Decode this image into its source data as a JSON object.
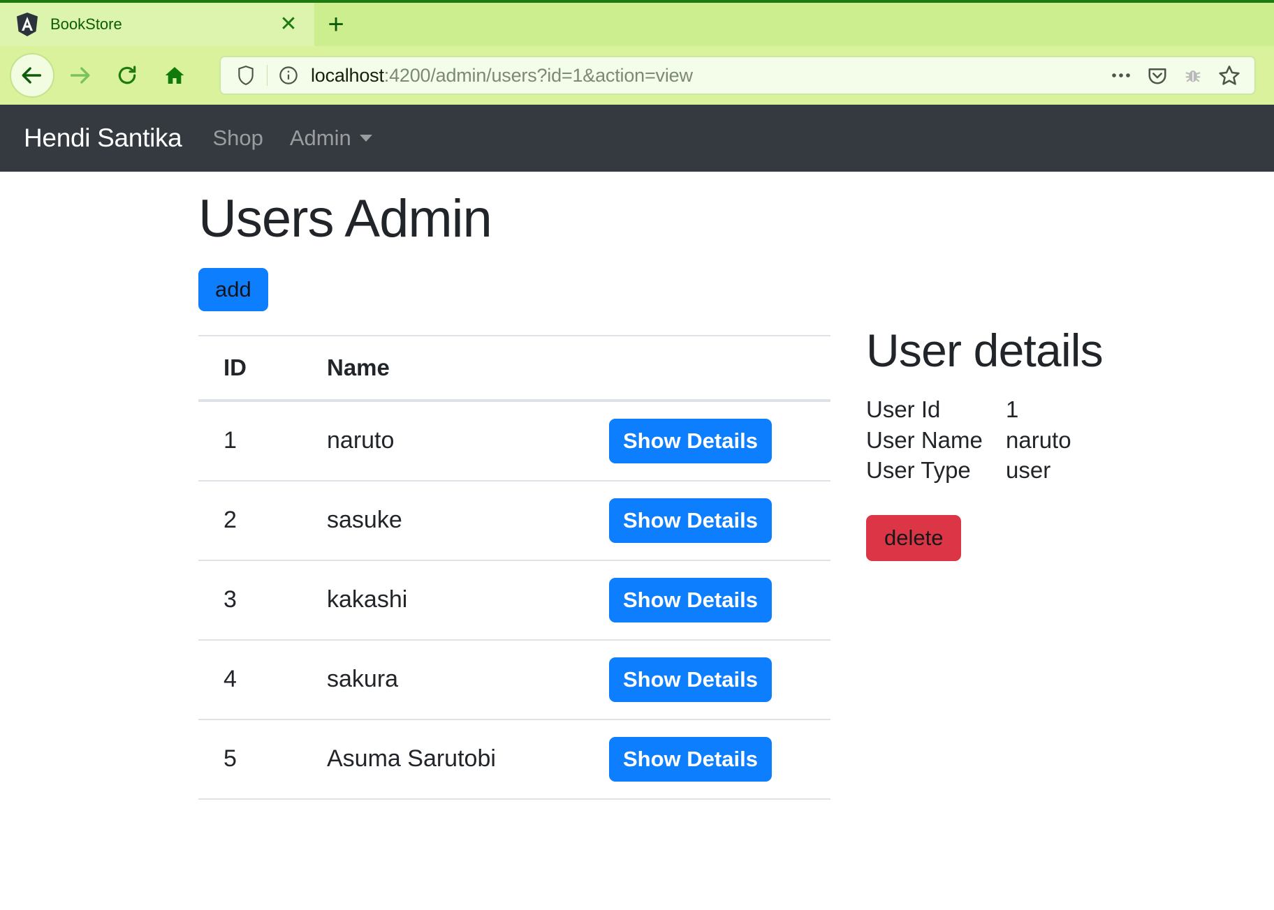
{
  "browser": {
    "tab": {
      "title": "BookStore",
      "favicon": "angular-logo-icon",
      "close": "✕"
    },
    "new_tab": "+",
    "nav": {
      "back": "back-arrow-icon",
      "forward": "forward-arrow-icon",
      "reload": "reload-icon",
      "home": "home-icon"
    },
    "url": {
      "host": "localhost",
      "rest": ":4200/admin/users?id=1&action=view",
      "full": "localhost:4200/admin/users?id=1&action=view",
      "shield_icon": "tracking-protection-shield-icon",
      "info_icon": "site-info-icon"
    },
    "url_actions": [
      "page-actions-ellipsis-icon",
      "pocket-icon",
      "debug-bug-icon",
      "bookmark-star-icon"
    ],
    "theme_accent": "#d9f29b"
  },
  "app_navbar": {
    "brand": "Hendi Santika",
    "links": [
      {
        "label": "Shop",
        "dropdown": false
      },
      {
        "label": "Admin",
        "dropdown": true
      }
    ]
  },
  "main": {
    "title": "Users Admin",
    "add_label": "add",
    "table": {
      "columns": [
        "ID",
        "Name",
        ""
      ],
      "action_label": "Show Details",
      "rows": [
        {
          "id": "1",
          "name": "naruto"
        },
        {
          "id": "2",
          "name": "sasuke"
        },
        {
          "id": "3",
          "name": "kakashi"
        },
        {
          "id": "4",
          "name": "sakura"
        },
        {
          "id": "5",
          "name": "Asuma Sarutobi"
        }
      ]
    }
  },
  "details": {
    "title": "User details",
    "fields": [
      {
        "label": "User Id",
        "value": "1"
      },
      {
        "label": "User Name",
        "value": "naruto"
      },
      {
        "label": "User Type",
        "value": "user"
      }
    ],
    "delete_label": "delete"
  },
  "colors": {
    "primary": "#0d7efd",
    "danger": "#dc3545",
    "navbar": "#343a40",
    "text": "#212529"
  }
}
